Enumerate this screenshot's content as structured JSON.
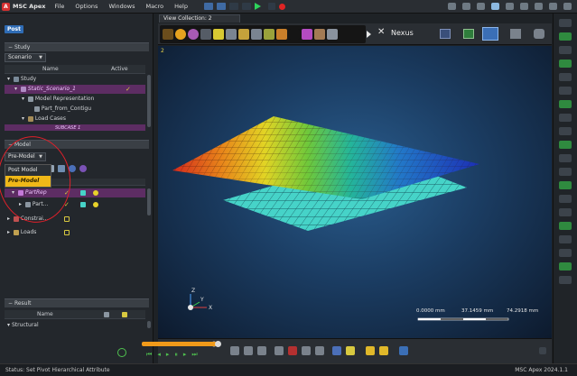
{
  "app": {
    "title": "MSC Apex",
    "version_label": "MSC Apex 2024.1.1"
  },
  "menu": [
    "File",
    "Options",
    "Windows",
    "Macro",
    "Help"
  ],
  "left_panel": {
    "mode_tab": "Post",
    "study_section": {
      "title": "Study",
      "dropdown": "Scenario",
      "columns": [
        "Name",
        "Active"
      ],
      "rows": [
        {
          "label": "Study"
        },
        {
          "label": "Static_Scenario_1",
          "active": "✓"
        },
        {
          "label": "Model Representation"
        },
        {
          "label": "Part_from_Contigu"
        },
        {
          "label": "Load Cases"
        },
        {
          "label": "SUBCASE 1"
        }
      ]
    },
    "model_section": {
      "title": "Model",
      "dropdown": "Pre-Model",
      "popup_options": [
        "Post Model",
        "Pre-Model"
      ],
      "rows": [
        {
          "label": "PartRep"
        },
        {
          "label": "Part..."
        },
        {
          "label": "Constrai..."
        },
        {
          "label": "Loads"
        }
      ]
    },
    "result_section": {
      "title": "Result",
      "columns": [
        "Name"
      ],
      "rows": [
        {
          "label": "Structural"
        }
      ]
    }
  },
  "viewport": {
    "tab_label": "View Collection: 2",
    "view_number": "2",
    "nexus_label": "Nexus",
    "scale_labels": [
      "0.0000 mm",
      "37.1459 mm",
      "74.2918 mm"
    ],
    "axes": {
      "x": "X",
      "y": "Y",
      "z": "Z"
    }
  },
  "status": {
    "text": "Status:  Set Pivot Hierarchical Attribute"
  },
  "colors": {
    "accent": "#2f6cb5",
    "selection": "#5d2d63",
    "highlight": "#f0b818",
    "annotation": "#e0202a",
    "mesh": "#46d3c8"
  }
}
